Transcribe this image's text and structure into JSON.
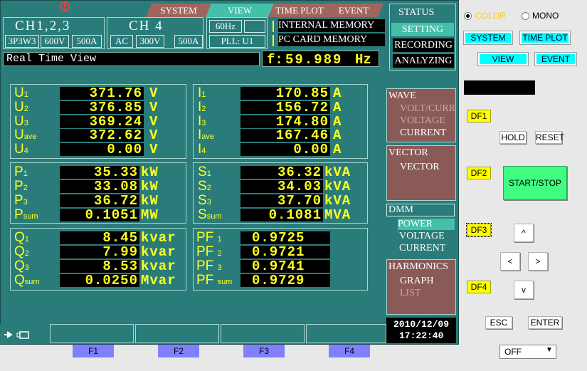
{
  "tabs": [
    "SYSTEM",
    "VIEW",
    "TIME PLOT",
    "EVENT"
  ],
  "channels": {
    "ch123_label": "CH1,2,3",
    "wiring": "3P3W3",
    "volt_range": "600V",
    "curr_range": "500A",
    "ch4_label": "CH 4",
    "ch4_mode": "AC",
    "ch4_volt": "300V",
    "ch4_curr": "500A",
    "freq": "60Hz",
    "pll": "PLL: U1"
  },
  "memory": {
    "internal": "INTERNAL MEMORY",
    "pc_card": "PC CARD  MEMORY"
  },
  "view_title": "Real Time View",
  "frequency": {
    "prefix": "f:",
    "value": "59.989",
    "unit": "Hz"
  },
  "voltage": [
    {
      "label": "U",
      "sub": "1",
      "value": "371.76",
      "unit": "V"
    },
    {
      "label": "U",
      "sub": "2",
      "value": "376.85",
      "unit": "V"
    },
    {
      "label": "U",
      "sub": "3",
      "value": "369.24",
      "unit": "V"
    },
    {
      "label": "U",
      "sub": "ave",
      "value": "372.62",
      "unit": "V"
    },
    {
      "label": "U",
      "sub": "4",
      "value": "0.00",
      "unit": "V"
    }
  ],
  "current": [
    {
      "label": "I",
      "sub": "1",
      "value": "170.85",
      "unit": "A"
    },
    {
      "label": "I",
      "sub": "2",
      "value": "156.72",
      "unit": "A"
    },
    {
      "label": "I",
      "sub": "3",
      "value": "174.80",
      "unit": "A"
    },
    {
      "label": "I",
      "sub": "ave",
      "value": "167.46",
      "unit": "A"
    },
    {
      "label": "I",
      "sub": "4",
      "value": "0.00",
      "unit": "A"
    }
  ],
  "active_power": [
    {
      "label": "P",
      "sub": "1",
      "value": "35.33",
      "unit": "kW"
    },
    {
      "label": "P",
      "sub": "2",
      "value": "33.08",
      "unit": "kW"
    },
    {
      "label": "P",
      "sub": "3",
      "value": "36.72",
      "unit": "kW"
    },
    {
      "label": "P",
      "sub": "sum",
      "value": "0.1051",
      "unit": "MW"
    }
  ],
  "apparent_power": [
    {
      "label": "S",
      "sub": "1",
      "value": "36.32",
      "unit": "kVA"
    },
    {
      "label": "S",
      "sub": "2",
      "value": "34.03",
      "unit": "kVA"
    },
    {
      "label": "S",
      "sub": "3",
      "value": "37.70",
      "unit": "kVA"
    },
    {
      "label": "S",
      "sub": "sum",
      "value": "0.1081",
      "unit": "MVA"
    }
  ],
  "reactive_power": [
    {
      "label": "Q",
      "sub": "1",
      "value": "8.45",
      "unit": "kvar"
    },
    {
      "label": "Q",
      "sub": "2",
      "value": "7.99",
      "unit": "kvar"
    },
    {
      "label": "Q",
      "sub": "3",
      "value": "8.53",
      "unit": "kvar"
    },
    {
      "label": "Q",
      "sub": "sum",
      "value": "0.0250",
      "unit": "Mvar"
    }
  ],
  "power_factor": [
    {
      "label": "PF",
      "sub": "1",
      "value": "0.9725"
    },
    {
      "label": "PF",
      "sub": "2",
      "value": "0.9721"
    },
    {
      "label": "PF",
      "sub": "3",
      "value": "0.9741"
    },
    {
      "label": "PF",
      "sub": "sum",
      "value": "0.9729"
    }
  ],
  "status_menu": [
    "STATUS",
    "SETTING",
    "RECORDING",
    "ANALYZING"
  ],
  "wave_menu": {
    "title": "WAVE",
    "items": [
      "VOLT/CURR",
      "VOLTAGE",
      "CURRENT"
    ]
  },
  "vector_menu": {
    "title": "VECTOR",
    "items": [
      "VECTOR"
    ]
  },
  "dmm_menu": {
    "title": "DMM",
    "items": [
      "POWER",
      "VOLTAGE",
      "CURRENT"
    ]
  },
  "harmonics_menu": {
    "title": "HARMONICS",
    "items": [
      "GRAPH",
      "LIST"
    ]
  },
  "datetime": {
    "date": "2010/12/09",
    "time": "17:22:40"
  },
  "function_keys": [
    "F1",
    "F2",
    "F3",
    "F4"
  ],
  "controls": {
    "color_label": "COLOR",
    "mono_label": "MONO",
    "system": "SYSTEM",
    "time_plot": "TIME PLOT",
    "view": "VIEW",
    "event": "EVENT",
    "df1": "DF1",
    "df2": "DF2",
    "df3": "DF3",
    "df4": "DF4",
    "hold": "HOLD",
    "reset": "RESET",
    "start_stop": "START/STOP",
    "up": "^",
    "left": "<",
    "right": ">",
    "down": "v",
    "esc": "ESC",
    "enter": "ENTER",
    "select_value": "OFF"
  },
  "colors": {
    "screen_bg": "#2a7c7a",
    "value_text": "#ffff20",
    "menu_bg": "#8a5a58",
    "active_tab": "#44bfa8"
  }
}
